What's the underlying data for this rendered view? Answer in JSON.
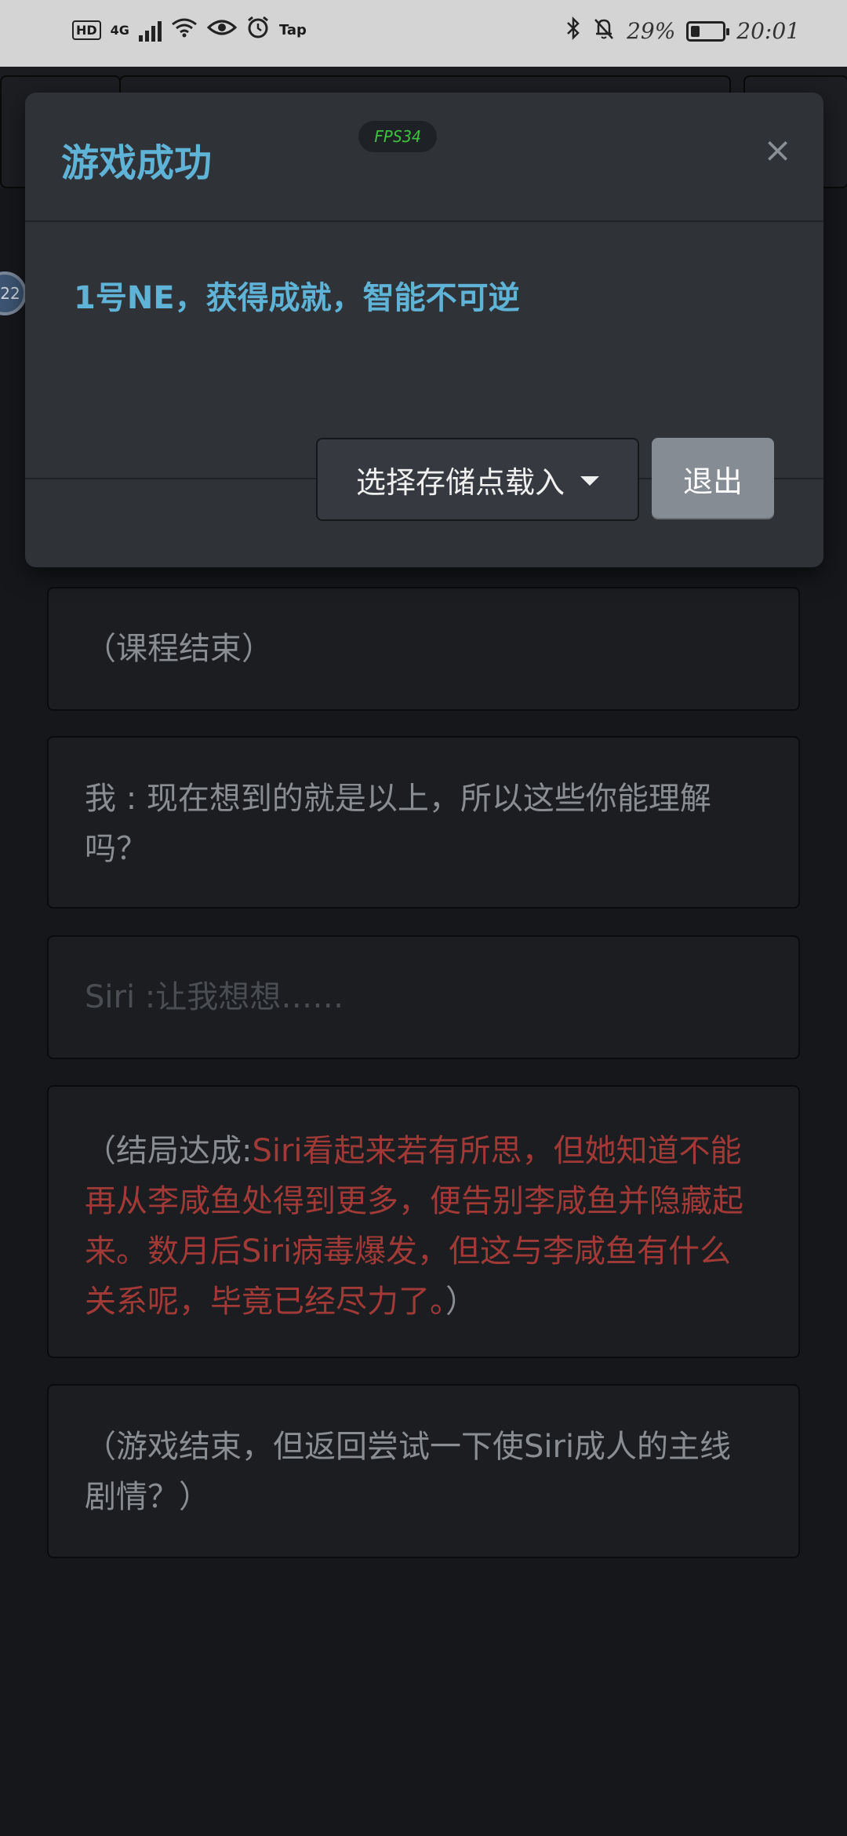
{
  "status_bar": {
    "left": {
      "hd": "HD",
      "network": "4G",
      "extra": "Tap"
    },
    "right": {
      "battery": "29%",
      "time": "20:01"
    }
  },
  "background": {
    "avatar_text": "22"
  },
  "modal": {
    "title": "游戏成功",
    "fps": "FPS34",
    "close_symbol": "×",
    "message": "1号NE，获得成就，智能不可逆",
    "select_button_label": "选择存储点载入",
    "exit_button_label": "退出"
  },
  "story": [
    {
      "text": "（课程结束）"
    },
    {
      "text": "我 : 现在想到的就是以上，所以这些你能理解吗？"
    },
    {
      "text": "Siri :让我想想……"
    },
    {
      "prefix": "（结局达成:",
      "highlight": "Siri看起来若有所思，但她知道不能再从李咸鱼处得到更多，便告别李咸鱼并隐藏起来。数月后Siri病毒爆发，但这与李咸鱼有什么关系呢，毕竟已经尽力了。",
      "suffix": "）"
    },
    {
      "text": "（游戏结束，但返回尝试一下使Siri成人的主线剧情？）"
    }
  ],
  "colors": {
    "accent": "#5fb3d6",
    "fps_green": "#3ec13e",
    "ending_red": "#a13a36",
    "background": "#15171b",
    "modal_bg": "#2f3338"
  }
}
